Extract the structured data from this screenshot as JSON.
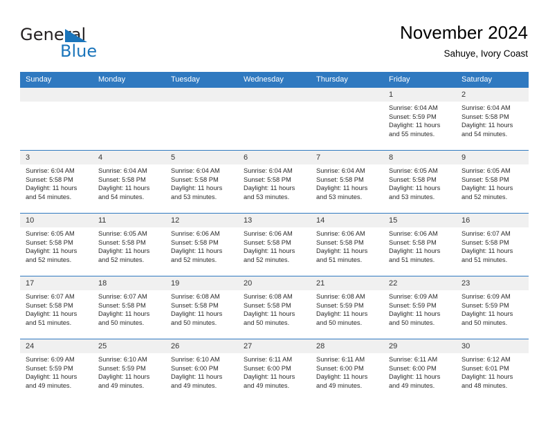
{
  "brand": {
    "name_part1": "General",
    "name_part2": "Blue",
    "triangle_color": "#1b75bb"
  },
  "header": {
    "month_title": "November 2024",
    "location": "Sahuye, Ivory Coast"
  },
  "theme": {
    "header_blue": "#2f79c0",
    "daynum_bg": "#f0f0f0",
    "text_color": "#2a2a2a"
  },
  "weekday_headers": [
    "Sunday",
    "Monday",
    "Tuesday",
    "Wednesday",
    "Thursday",
    "Friday",
    "Saturday"
  ],
  "weeks": [
    [
      {
        "day": "",
        "sunrise": "",
        "sunset": "",
        "daylight": ""
      },
      {
        "day": "",
        "sunrise": "",
        "sunset": "",
        "daylight": ""
      },
      {
        "day": "",
        "sunrise": "",
        "sunset": "",
        "daylight": ""
      },
      {
        "day": "",
        "sunrise": "",
        "sunset": "",
        "daylight": ""
      },
      {
        "day": "",
        "sunrise": "",
        "sunset": "",
        "daylight": ""
      },
      {
        "day": "1",
        "sunrise": "Sunrise: 6:04 AM",
        "sunset": "Sunset: 5:59 PM",
        "daylight": "Daylight: 11 hours and 55 minutes."
      },
      {
        "day": "2",
        "sunrise": "Sunrise: 6:04 AM",
        "sunset": "Sunset: 5:58 PM",
        "daylight": "Daylight: 11 hours and 54 minutes."
      }
    ],
    [
      {
        "day": "3",
        "sunrise": "Sunrise: 6:04 AM",
        "sunset": "Sunset: 5:58 PM",
        "daylight": "Daylight: 11 hours and 54 minutes."
      },
      {
        "day": "4",
        "sunrise": "Sunrise: 6:04 AM",
        "sunset": "Sunset: 5:58 PM",
        "daylight": "Daylight: 11 hours and 54 minutes."
      },
      {
        "day": "5",
        "sunrise": "Sunrise: 6:04 AM",
        "sunset": "Sunset: 5:58 PM",
        "daylight": "Daylight: 11 hours and 53 minutes."
      },
      {
        "day": "6",
        "sunrise": "Sunrise: 6:04 AM",
        "sunset": "Sunset: 5:58 PM",
        "daylight": "Daylight: 11 hours and 53 minutes."
      },
      {
        "day": "7",
        "sunrise": "Sunrise: 6:04 AM",
        "sunset": "Sunset: 5:58 PM",
        "daylight": "Daylight: 11 hours and 53 minutes."
      },
      {
        "day": "8",
        "sunrise": "Sunrise: 6:05 AM",
        "sunset": "Sunset: 5:58 PM",
        "daylight": "Daylight: 11 hours and 53 minutes."
      },
      {
        "day": "9",
        "sunrise": "Sunrise: 6:05 AM",
        "sunset": "Sunset: 5:58 PM",
        "daylight": "Daylight: 11 hours and 52 minutes."
      }
    ],
    [
      {
        "day": "10",
        "sunrise": "Sunrise: 6:05 AM",
        "sunset": "Sunset: 5:58 PM",
        "daylight": "Daylight: 11 hours and 52 minutes."
      },
      {
        "day": "11",
        "sunrise": "Sunrise: 6:05 AM",
        "sunset": "Sunset: 5:58 PM",
        "daylight": "Daylight: 11 hours and 52 minutes."
      },
      {
        "day": "12",
        "sunrise": "Sunrise: 6:06 AM",
        "sunset": "Sunset: 5:58 PM",
        "daylight": "Daylight: 11 hours and 52 minutes."
      },
      {
        "day": "13",
        "sunrise": "Sunrise: 6:06 AM",
        "sunset": "Sunset: 5:58 PM",
        "daylight": "Daylight: 11 hours and 52 minutes."
      },
      {
        "day": "14",
        "sunrise": "Sunrise: 6:06 AM",
        "sunset": "Sunset: 5:58 PM",
        "daylight": "Daylight: 11 hours and 51 minutes."
      },
      {
        "day": "15",
        "sunrise": "Sunrise: 6:06 AM",
        "sunset": "Sunset: 5:58 PM",
        "daylight": "Daylight: 11 hours and 51 minutes."
      },
      {
        "day": "16",
        "sunrise": "Sunrise: 6:07 AM",
        "sunset": "Sunset: 5:58 PM",
        "daylight": "Daylight: 11 hours and 51 minutes."
      }
    ],
    [
      {
        "day": "17",
        "sunrise": "Sunrise: 6:07 AM",
        "sunset": "Sunset: 5:58 PM",
        "daylight": "Daylight: 11 hours and 51 minutes."
      },
      {
        "day": "18",
        "sunrise": "Sunrise: 6:07 AM",
        "sunset": "Sunset: 5:58 PM",
        "daylight": "Daylight: 11 hours and 50 minutes."
      },
      {
        "day": "19",
        "sunrise": "Sunrise: 6:08 AM",
        "sunset": "Sunset: 5:58 PM",
        "daylight": "Daylight: 11 hours and 50 minutes."
      },
      {
        "day": "20",
        "sunrise": "Sunrise: 6:08 AM",
        "sunset": "Sunset: 5:58 PM",
        "daylight": "Daylight: 11 hours and 50 minutes."
      },
      {
        "day": "21",
        "sunrise": "Sunrise: 6:08 AM",
        "sunset": "Sunset: 5:59 PM",
        "daylight": "Daylight: 11 hours and 50 minutes."
      },
      {
        "day": "22",
        "sunrise": "Sunrise: 6:09 AM",
        "sunset": "Sunset: 5:59 PM",
        "daylight": "Daylight: 11 hours and 50 minutes."
      },
      {
        "day": "23",
        "sunrise": "Sunrise: 6:09 AM",
        "sunset": "Sunset: 5:59 PM",
        "daylight": "Daylight: 11 hours and 50 minutes."
      }
    ],
    [
      {
        "day": "24",
        "sunrise": "Sunrise: 6:09 AM",
        "sunset": "Sunset: 5:59 PM",
        "daylight": "Daylight: 11 hours and 49 minutes."
      },
      {
        "day": "25",
        "sunrise": "Sunrise: 6:10 AM",
        "sunset": "Sunset: 5:59 PM",
        "daylight": "Daylight: 11 hours and 49 minutes."
      },
      {
        "day": "26",
        "sunrise": "Sunrise: 6:10 AM",
        "sunset": "Sunset: 6:00 PM",
        "daylight": "Daylight: 11 hours and 49 minutes."
      },
      {
        "day": "27",
        "sunrise": "Sunrise: 6:11 AM",
        "sunset": "Sunset: 6:00 PM",
        "daylight": "Daylight: 11 hours and 49 minutes."
      },
      {
        "day": "28",
        "sunrise": "Sunrise: 6:11 AM",
        "sunset": "Sunset: 6:00 PM",
        "daylight": "Daylight: 11 hours and 49 minutes."
      },
      {
        "day": "29",
        "sunrise": "Sunrise: 6:11 AM",
        "sunset": "Sunset: 6:00 PM",
        "daylight": "Daylight: 11 hours and 49 minutes."
      },
      {
        "day": "30",
        "sunrise": "Sunrise: 6:12 AM",
        "sunset": "Sunset: 6:01 PM",
        "daylight": "Daylight: 11 hours and 48 minutes."
      }
    ]
  ]
}
